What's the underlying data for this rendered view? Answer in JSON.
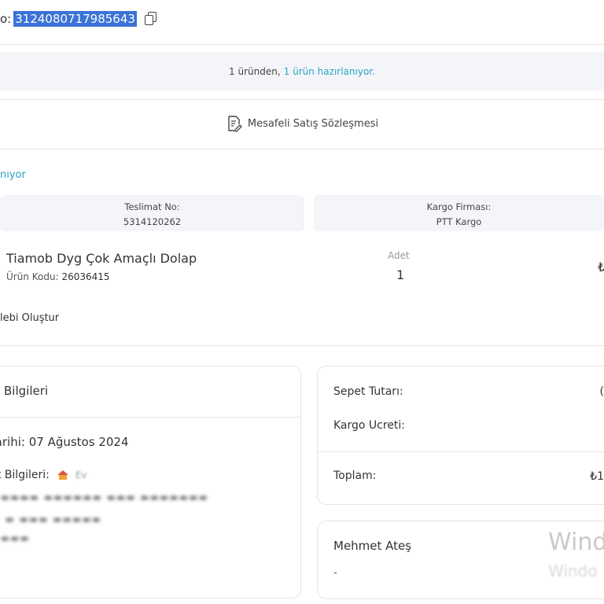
{
  "order": {
    "label": "o:",
    "number": "3124080717985643"
  },
  "status_banner": {
    "prefix": "1 üründen,",
    "highlight": "1 ürün hazırlanıyor."
  },
  "contract": {
    "label": "Mesafeli Satış Sözleşmesi"
  },
  "package": {
    "status": "nıyor",
    "delivery_no_label": "Teslimat No:",
    "delivery_no": "5314120262",
    "cargo_label": "Kargo Firması:",
    "cargo_company": "PTT Kargo"
  },
  "product": {
    "name": "Tiamob Dyg Çok Amaçlı Dolap",
    "code_label": "Ürün Kodu:",
    "code": "26036415",
    "qty_label": "Adet",
    "qty": "1",
    "price_fragment": "₺",
    "request_action": "lebi Oluştur"
  },
  "order_info": {
    "title": "Bilgileri",
    "date_label": "Tarihi:",
    "date": "07 Ağustos 2024",
    "delivery_label": "nt Bilgileri:",
    "address_name": "Ev"
  },
  "summary": {
    "basket_label": "Sepet Tutarı:",
    "shipping_label": "Kargo Ucreti:",
    "total_label": "Toplam:",
    "basket_fragment": "(",
    "total_fragment": "₺1"
  },
  "customer": {
    "name": "Mehmet Ateş",
    "phone": "-"
  },
  "watermark": {
    "line1": "Wind",
    "line2": "Windo"
  }
}
